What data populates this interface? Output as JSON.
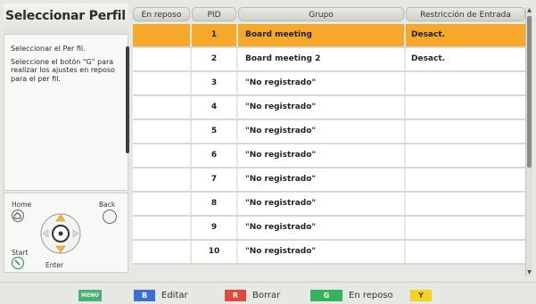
{
  "left_panel": {
    "title": "Seleccionar Perfil",
    "help_line1": "Seleccionar el Per fil.",
    "help_line2": "Seleccione el botón \"G\" para realizar los ajustes en reposo para el per fil.",
    "remote": {
      "home": "Home",
      "back": "Back",
      "start": "Start",
      "enter": "Enter"
    }
  },
  "table": {
    "headers": [
      "En reposo",
      "PID",
      "Grupo",
      "Restricción de Entrada"
    ],
    "rows": [
      {
        "reposo": "",
        "pid": "1",
        "grupo": "Board meeting",
        "restriccion": "Desact.",
        "selected": true
      },
      {
        "reposo": "",
        "pid": "2",
        "grupo": "Board meeting 2",
        "restriccion": "Desact.",
        "selected": false
      },
      {
        "reposo": "",
        "pid": "3",
        "grupo": "\"No registrado\"",
        "restriccion": "",
        "selected": false
      },
      {
        "reposo": "",
        "pid": "4",
        "grupo": "\"No registrado\"",
        "restriccion": "",
        "selected": false
      },
      {
        "reposo": "",
        "pid": "5",
        "grupo": "\"No registrado\"",
        "restriccion": "",
        "selected": false
      },
      {
        "reposo": "",
        "pid": "6",
        "grupo": "\"No registrado\"",
        "restriccion": "",
        "selected": false
      },
      {
        "reposo": "",
        "pid": "7",
        "grupo": "\"No registrado\"",
        "restriccion": "",
        "selected": false
      },
      {
        "reposo": "",
        "pid": "8",
        "grupo": "\"No registrado\"",
        "restriccion": "",
        "selected": false
      },
      {
        "reposo": "",
        "pid": "9",
        "grupo": "\"No registrado\"",
        "restriccion": "",
        "selected": false
      },
      {
        "reposo": "",
        "pid": "10",
        "grupo": "\"No registrado\"",
        "restriccion": "",
        "selected": false
      }
    ]
  },
  "bottom_bar": {
    "menu_key": "MENU",
    "b_key": "B",
    "b_label": "Editar",
    "r_key": "R",
    "r_label": "Borrar",
    "g_key": "G",
    "g_label": "En reposo",
    "y_key": "Y"
  },
  "colors": {
    "selected_row": "#f5a82a",
    "key_menu": "#4caf7a",
    "key_blue": "#3f6fd0",
    "key_red": "#e04a3c",
    "key_green": "#35b35a",
    "key_yellow": "#f4d21f"
  }
}
